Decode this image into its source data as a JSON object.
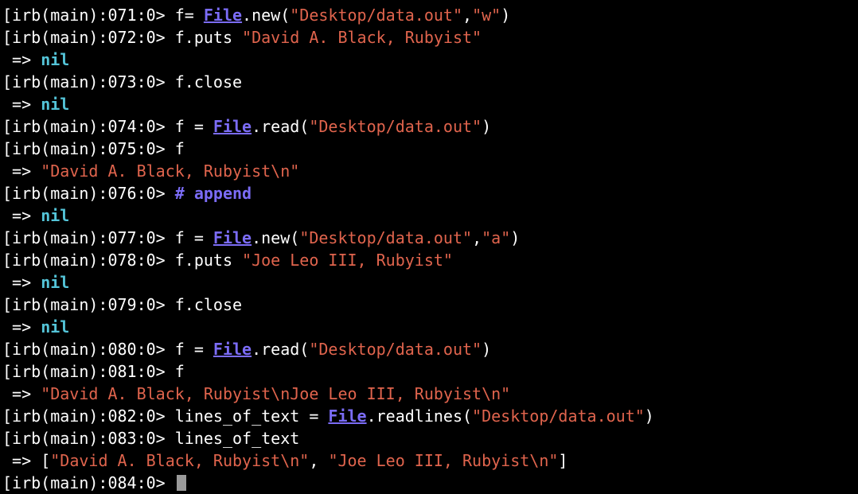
{
  "terminal": {
    "lines": [
      {
        "kind": "in",
        "prompt": "irb(main):071:0>",
        "parts": [
          {
            "t": "f= "
          },
          {
            "t": "File",
            "c": "cls"
          },
          {
            "t": ".new("
          },
          {
            "t": "\"Desktop/data.out\"",
            "c": "str"
          },
          {
            "t": ","
          },
          {
            "t": "\"w\"",
            "c": "str"
          },
          {
            "t": ")"
          }
        ]
      },
      {
        "kind": "in",
        "prompt": "irb(main):072:0>",
        "parts": [
          {
            "t": "f.puts "
          },
          {
            "t": "\"David A. Black, Rubyist\"",
            "c": "str"
          }
        ]
      },
      {
        "kind": "out",
        "arrow": "=>",
        "parts": [
          {
            "t": "nil",
            "c": "nil"
          }
        ]
      },
      {
        "kind": "in",
        "prompt": "irb(main):073:0>",
        "parts": [
          {
            "t": "f.close"
          }
        ]
      },
      {
        "kind": "out",
        "arrow": "=>",
        "parts": [
          {
            "t": "nil",
            "c": "nil"
          }
        ]
      },
      {
        "kind": "in",
        "prompt": "irb(main):074:0>",
        "parts": [
          {
            "t": "f = "
          },
          {
            "t": "File",
            "c": "cls"
          },
          {
            "t": ".read("
          },
          {
            "t": "\"Desktop/data.out\"",
            "c": "str"
          },
          {
            "t": ")"
          }
        ]
      },
      {
        "kind": "in",
        "prompt": "irb(main):075:0>",
        "parts": [
          {
            "t": "f"
          }
        ]
      },
      {
        "kind": "out",
        "arrow": "=>",
        "parts": [
          {
            "t": "\"David A. Black, Rubyist\\n\"",
            "c": "str"
          }
        ]
      },
      {
        "kind": "in",
        "prompt": "irb(main):076:0>",
        "parts": [
          {
            "t": "# append",
            "c": "comment"
          }
        ]
      },
      {
        "kind": "out",
        "arrow": "=>",
        "parts": [
          {
            "t": "nil",
            "c": "nil"
          }
        ]
      },
      {
        "kind": "in",
        "prompt": "irb(main):077:0>",
        "parts": [
          {
            "t": "f = "
          },
          {
            "t": "File",
            "c": "cls"
          },
          {
            "t": ".new("
          },
          {
            "t": "\"Desktop/data.out\"",
            "c": "str"
          },
          {
            "t": ","
          },
          {
            "t": "\"a\"",
            "c": "str"
          },
          {
            "t": ")"
          }
        ]
      },
      {
        "kind": "in",
        "prompt": "irb(main):078:0>",
        "parts": [
          {
            "t": "f.puts "
          },
          {
            "t": "\"Joe Leo III, Rubyist\"",
            "c": "str"
          }
        ]
      },
      {
        "kind": "out",
        "arrow": "=>",
        "parts": [
          {
            "t": "nil",
            "c": "nil"
          }
        ]
      },
      {
        "kind": "in",
        "prompt": "irb(main):079:0>",
        "parts": [
          {
            "t": "f.close"
          }
        ]
      },
      {
        "kind": "out",
        "arrow": "=>",
        "parts": [
          {
            "t": "nil",
            "c": "nil"
          }
        ]
      },
      {
        "kind": "in",
        "prompt": "irb(main):080:0>",
        "parts": [
          {
            "t": "f = "
          },
          {
            "t": "File",
            "c": "cls"
          },
          {
            "t": ".read("
          },
          {
            "t": "\"Desktop/data.out\"",
            "c": "str"
          },
          {
            "t": ")"
          }
        ]
      },
      {
        "kind": "in",
        "prompt": "irb(main):081:0>",
        "parts": [
          {
            "t": "f"
          }
        ]
      },
      {
        "kind": "out",
        "arrow": "=>",
        "parts": [
          {
            "t": "\"David A. Black, Rubyist\\nJoe Leo III, Rubyist\\n\"",
            "c": "str"
          }
        ]
      },
      {
        "kind": "in",
        "prompt": "irb(main):082:0>",
        "parts": [
          {
            "t": "lines_of_text = "
          },
          {
            "t": "File",
            "c": "cls"
          },
          {
            "t": ".readlines("
          },
          {
            "t": "\"Desktop/data.out\"",
            "c": "str"
          },
          {
            "t": ")"
          }
        ]
      },
      {
        "kind": "in",
        "prompt": "irb(main):083:0>",
        "parts": [
          {
            "t": "lines_of_text"
          }
        ]
      },
      {
        "kind": "out",
        "arrow": "=>",
        "parts": [
          {
            "t": "["
          },
          {
            "t": "\"David A. Black, Rubyist\\n\"",
            "c": "str"
          },
          {
            "t": ", "
          },
          {
            "t": "\"Joe Leo III, Rubyist\\n\"",
            "c": "str"
          },
          {
            "t": "]"
          }
        ]
      },
      {
        "kind": "in",
        "prompt": "irb(main):084:0>",
        "parts": [],
        "cursor": true
      }
    ]
  },
  "colors": {
    "background": "#000000",
    "text": "#ffffff",
    "string": "#e0644d",
    "class_constant": "#7b6cf6",
    "nil_keyword": "#54c4d8",
    "comment": "#7b6cf6",
    "cursor": "#9a9a9a"
  },
  "icons": {
    "cursor": "block-cursor-icon"
  }
}
